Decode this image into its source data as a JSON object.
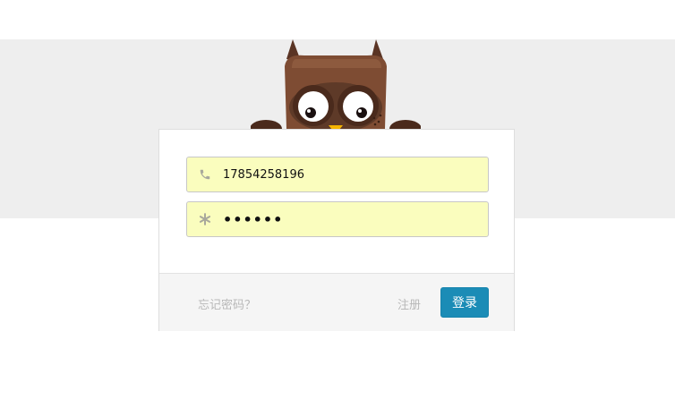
{
  "login_form": {
    "phone_value": "17854258196",
    "password_value": "••••••",
    "phone_icon": "phone-icon",
    "password_icon": "asterisk-icon"
  },
  "footer": {
    "forgot_label": "忘记密码？",
    "register_label": "注册",
    "login_label": "登录"
  },
  "colors": {
    "band": "#eeeeee",
    "field_bg": "#fafdbe",
    "login_button": "#1b8cb6",
    "owl_brown": "#7a4a32",
    "owl_dark": "#4a2a1c"
  }
}
